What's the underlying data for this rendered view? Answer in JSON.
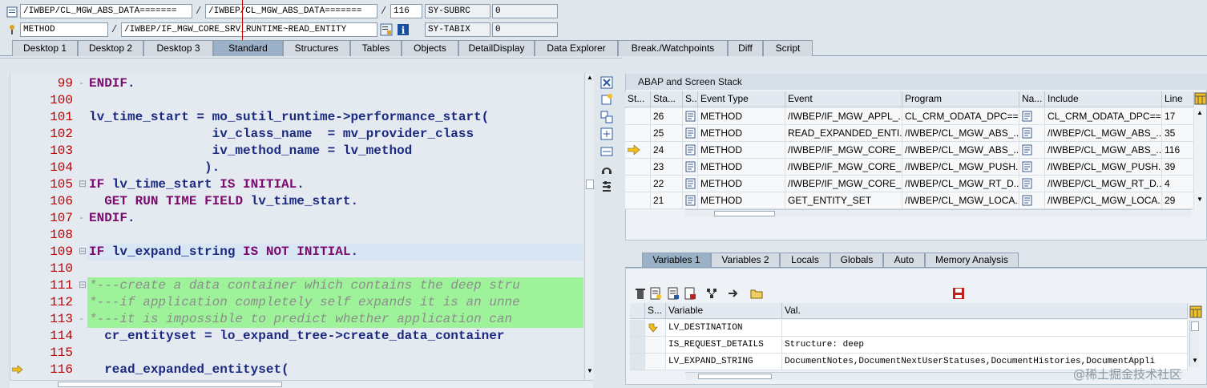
{
  "topbar": {
    "row1": {
      "field1": "/IWBEP/CL_MGW_ABS_DATA=======",
      "field2": "/IWBEP/CL_MGW_ABS_DATA=======",
      "line": "116",
      "sysvar": "SY-SUBRC",
      "sysval": "0"
    },
    "row2": {
      "field1": "METHOD",
      "field2": "/IWBEP/IF_MGW_CORE_SRV_RUNTIME~READ_ENTITY",
      "sysvar": "SY-TABIX",
      "sysval": "0"
    },
    "separator": "/"
  },
  "tabs": [
    "Desktop 1",
    "Desktop 2",
    "Desktop 3",
    "Standard",
    "Structures",
    "Tables",
    "Objects",
    "DetailDisplay",
    "Data Explorer",
    "Break./Watchpoints",
    "Diff",
    "Script"
  ],
  "active_tab": "Standard",
  "editor": {
    "lines": [
      {
        "num": "99",
        "fold": "-",
        "code": "ENDIF."
      },
      {
        "num": "100",
        "fold": "",
        "code": ""
      },
      {
        "num": "101",
        "fold": "",
        "code": "lv_time_start = mo_sutil_runtime->performance_start("
      },
      {
        "num": "102",
        "fold": "",
        "code": "                iv_class_name  = mv_provider_class"
      },
      {
        "num": "103",
        "fold": "",
        "code": "                iv_method_name = lv_method"
      },
      {
        "num": "104",
        "fold": "",
        "code": "               )."
      },
      {
        "num": "105",
        "fold": "⊟",
        "code": "IF lv_time_start IS INITIAL."
      },
      {
        "num": "106",
        "fold": "",
        "code": "  GET RUN TIME FIELD lv_time_start."
      },
      {
        "num": "107",
        "fold": "-",
        "code": "ENDIF."
      },
      {
        "num": "108",
        "fold": "",
        "code": ""
      },
      {
        "num": "109",
        "fold": "⊟",
        "code": "IF lv_expand_string IS NOT INITIAL."
      },
      {
        "num": "110",
        "fold": "",
        "code": ""
      },
      {
        "num": "111",
        "fold": "⊟",
        "code": "*---create a data container which contains the deep stru"
      },
      {
        "num": "112",
        "fold": "",
        "code": "*---if application completely self expands it is an unne"
      },
      {
        "num": "113",
        "fold": "-",
        "code": "*---it is impossible to predict whether application can"
      },
      {
        "num": "114",
        "fold": "",
        "code": "  cr_entityset = lo_expand_tree->create_data_container"
      },
      {
        "num": "115",
        "fold": "",
        "code": ""
      },
      {
        "num": "116",
        "fold": "",
        "code": "  read_expanded_entityset("
      }
    ]
  },
  "stack": {
    "title": "ABAP and Screen Stack",
    "columns": [
      "St...",
      "Sta...",
      "S...",
      "Event Type",
      "Event",
      "Program",
      "Na...",
      "Include",
      "Line"
    ],
    "rows": [
      {
        "level": "26",
        "type": "METHOD",
        "event": "/IWBEP/IF_MGW_APPL_...",
        "program": "CL_CRM_ODATA_DPC==...",
        "include": "CL_CRM_ODATA_DPC==...",
        "line": "17",
        "current": false
      },
      {
        "level": "25",
        "type": "METHOD",
        "event": "READ_EXPANDED_ENTI...",
        "program": "/IWBEP/CL_MGW_ABS_...",
        "include": "/IWBEP/CL_MGW_ABS_...",
        "line": "35",
        "current": false
      },
      {
        "level": "24",
        "type": "METHOD",
        "event": "/IWBEP/IF_MGW_CORE_...",
        "program": "/IWBEP/CL_MGW_ABS_...",
        "include": "/IWBEP/CL_MGW_ABS_...",
        "line": "116",
        "current": true
      },
      {
        "level": "23",
        "type": "METHOD",
        "event": "/IWBEP/IF_MGW_CORE_...",
        "program": "/IWBEP/CL_MGW_PUSH...",
        "include": "/IWBEP/CL_MGW_PUSH...",
        "line": "39",
        "current": false
      },
      {
        "level": "22",
        "type": "METHOD",
        "event": "/IWBEP/IF_MGW_CORE_...",
        "program": "/IWBEP/CL_MGW_RT_D...",
        "include": "/IWBEP/CL_MGW_RT_D...",
        "line": "4",
        "current": false
      },
      {
        "level": "21",
        "type": "METHOD",
        "event": "GET_ENTITY_SET",
        "program": "/IWBEP/CL_MGW_LOCA...",
        "include": "/IWBEP/CL_MGW_LOCA...",
        "line": "29",
        "current": false
      }
    ]
  },
  "var_tabs": [
    "Variables 1",
    "Variables 2",
    "Locals",
    "Globals",
    "Auto",
    "Memory Analysis"
  ],
  "active_var_tab": "Variables 1",
  "variables": {
    "columns": [
      "S...",
      "Variable",
      "Val."
    ],
    "rows": [
      {
        "name": "LV_DESTINATION",
        "value": ""
      },
      {
        "name": "IS_REQUEST_DETAILS",
        "value": "Structure: deep"
      },
      {
        "name": "LV_EXPAND_STRING",
        "value": "DocumentNotes,DocumentNextUserStatuses,DocumentHistories,DocumentAppli"
      }
    ]
  },
  "watermark": "@稀土掘金技术社区",
  "colors": {
    "accent_tab": "#9bb1c8",
    "line_number": "#c00000",
    "keyword": "#7a0a6c",
    "comment_bg": "#9ef39a",
    "current_line_bg": "#d9e6f4"
  }
}
